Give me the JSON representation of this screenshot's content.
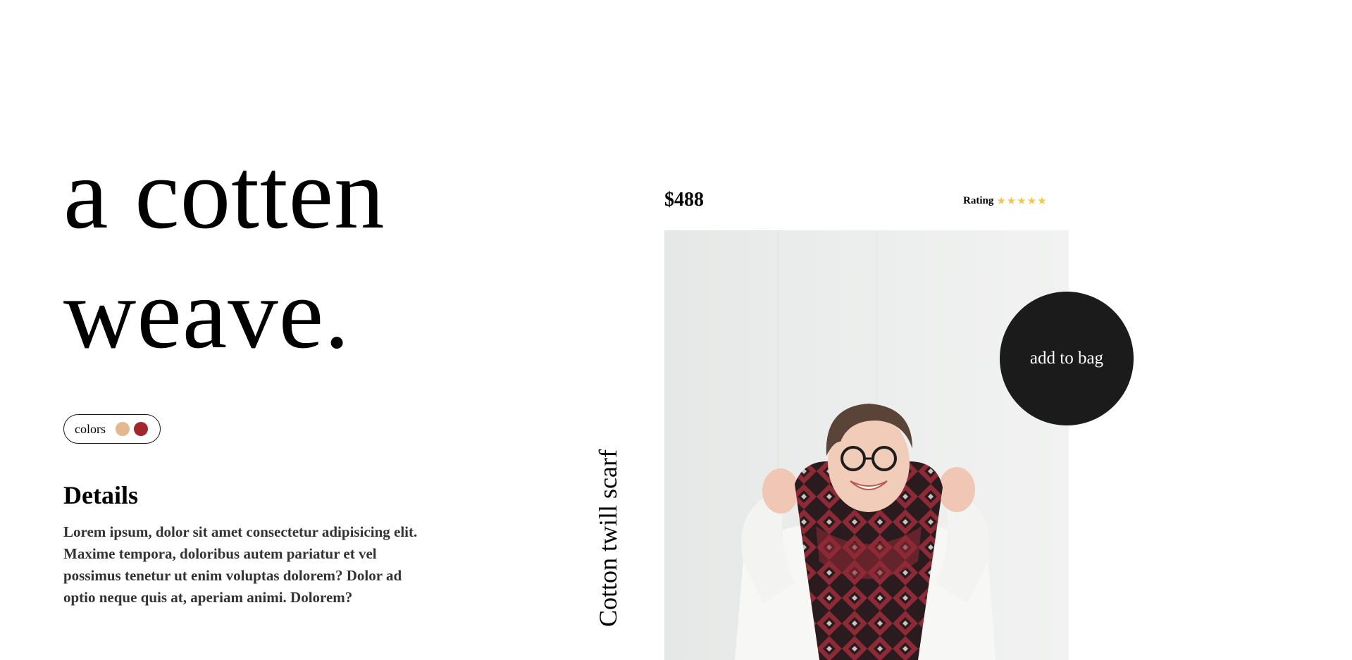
{
  "hero": {
    "line1": "a cotten",
    "line2": "weave."
  },
  "colors": {
    "label": "colors",
    "swatches": [
      {
        "name": "tan",
        "color": "#e2b98f"
      },
      {
        "name": "red",
        "color": "#a3262c"
      }
    ]
  },
  "details": {
    "heading": "Details",
    "body": "Lorem ipsum, dolor sit amet consectetur adipisicing elit. Maxime tempora, doloribus autem pariatur et vel possimus tenetur ut enim voluptas dolorem? Dolor ad optio neque quis at, aperiam animi. Dolorem?"
  },
  "product": {
    "price": "$488",
    "rating_label": "Rating",
    "rating_value": 5,
    "rating_max": 5,
    "stars": "★★★★★",
    "caption": "Cotton twill scarf",
    "add_to_bag_label": "add to bag",
    "image_alt": "smiling woman wearing red patterned scarf and white sweater"
  },
  "theme": {
    "star_color": "#f6c644",
    "button_color": "#1b1b1b",
    "swatch_tan": "#e2b98f",
    "swatch_red": "#a3262c"
  }
}
